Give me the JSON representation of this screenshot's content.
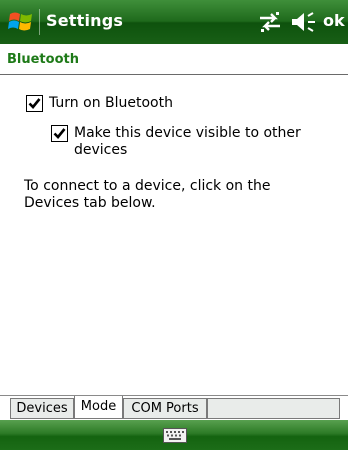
{
  "titlebar": {
    "title": "Settings",
    "ok_label": "ok",
    "start_icon": "windows-flag-icon",
    "connectivity_icon": "connectivity-arrows-icon",
    "volume_icon": "speaker-icon"
  },
  "page": {
    "header": "Bluetooth",
    "turn_on_label": "Turn on Bluetooth",
    "turn_on_checked": true,
    "visible_label": "Make this device visible to other devices",
    "visible_checked": true,
    "info": "To connect to a device, click on the Devices tab below."
  },
  "tabs": [
    {
      "label": "Devices",
      "active": false
    },
    {
      "label": "Mode",
      "active": true
    },
    {
      "label": "COM Ports",
      "active": false
    }
  ],
  "softkey": {
    "center_icon": "keyboard-icon"
  },
  "colors": {
    "header_text": "#1e7a18",
    "bar_green": "#1f6a1c"
  }
}
